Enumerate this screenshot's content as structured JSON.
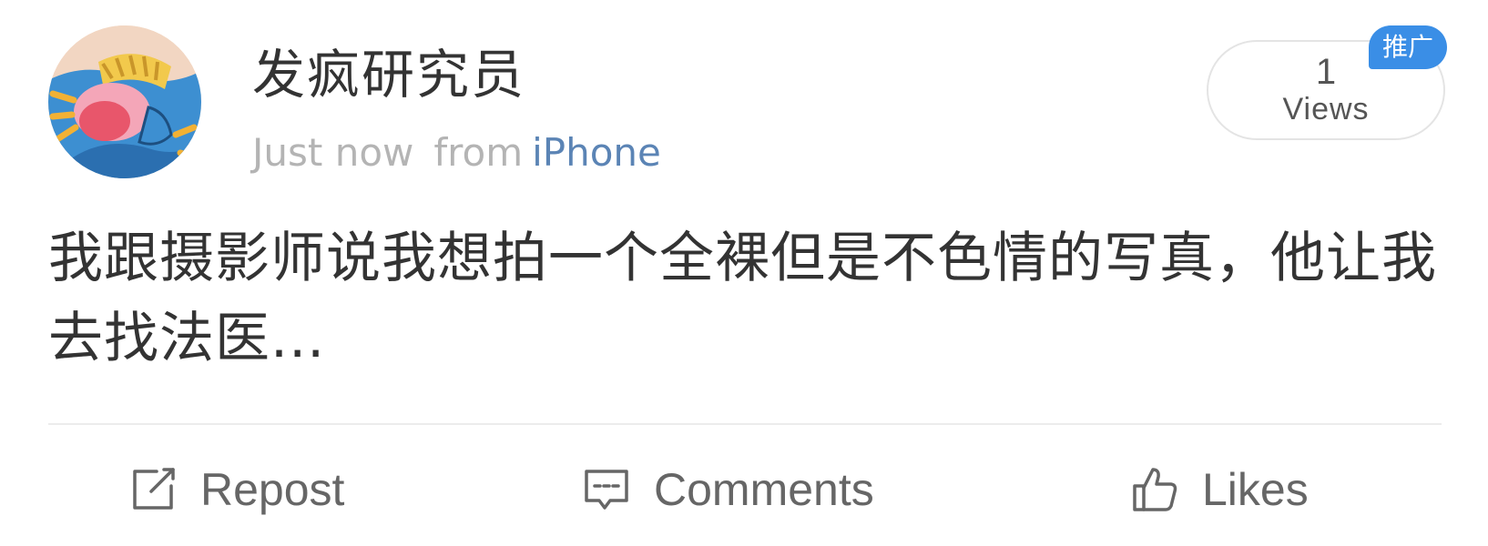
{
  "post": {
    "author": "发疯研究员",
    "timestamp": "Just now",
    "source_label": "from",
    "device": "iPhone",
    "text": "我跟摄影师说我想拍一个全裸但是不色情的写真，他让我去找法医..."
  },
  "views": {
    "count": "1",
    "label": "Views",
    "promo_badge": "推广"
  },
  "actions": {
    "repost_label": "Repost",
    "comments_label": "Comments",
    "likes_label": "Likes"
  },
  "icons": {
    "repost": "repost-icon",
    "comments": "comment-icon",
    "likes": "thumbs-up-icon"
  },
  "colors": {
    "link_blue": "#5b84b5",
    "badge_blue": "#3a8ee6",
    "meta_gray": "#b4b4b4"
  }
}
